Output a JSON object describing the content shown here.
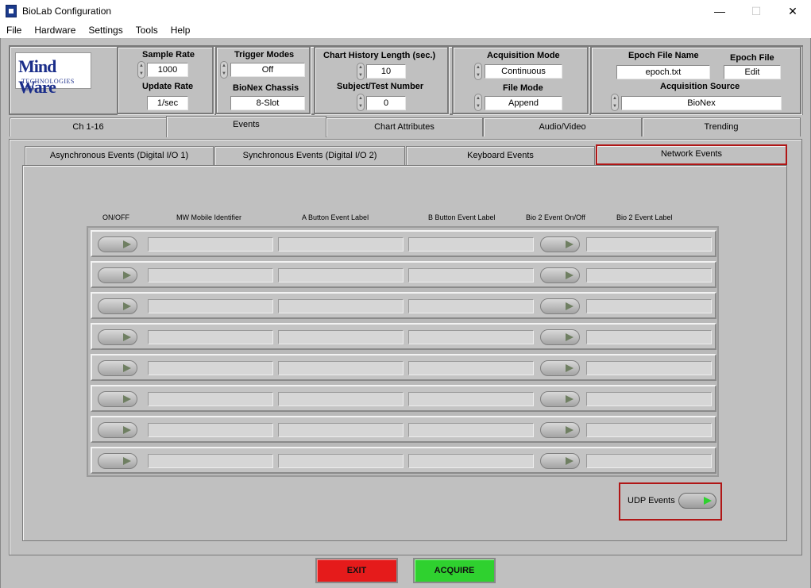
{
  "window": {
    "title": "BioLab Configuration",
    "minimize_glyph": "—",
    "maximize_glyph": "☐",
    "close_glyph": "✕"
  },
  "menu": [
    "File",
    "Hardware",
    "Settings",
    "Tools",
    "Help"
  ],
  "logo": {
    "main": "Mind Ware",
    "sub": "TECHNOLOGIES LTD."
  },
  "settings": {
    "sample_rate_label": "Sample Rate",
    "sample_rate": "1000",
    "update_rate_label": "Update Rate",
    "update_rate": "1/sec",
    "trigger_modes_label": "Trigger Modes",
    "trigger_modes": "Off",
    "bionex_chassis_label": "BioNex Chassis",
    "bionex_chassis": "8-Slot",
    "chart_history_label": "Chart History Length (sec.)",
    "chart_history": "10",
    "subject_test_label": "Subject/Test Number",
    "subject_test": "0",
    "acquisition_mode_label": "Acquisition Mode",
    "acquisition_mode": "Continuous",
    "file_mode_label": "File Mode",
    "file_mode": "Append",
    "epoch_file_name_label": "Epoch File Name",
    "epoch_file_name": "epoch.txt",
    "epoch_file_label": "Epoch File",
    "epoch_file_edit": "Edit",
    "acquisition_source_label": "Acquisition Source",
    "acquisition_source": "BioNex"
  },
  "tabs": [
    {
      "label": "Ch 1-16",
      "active": false
    },
    {
      "label": "Events",
      "active": true
    },
    {
      "label": "Chart Attributes",
      "active": false
    },
    {
      "label": "Audio/Video",
      "active": false
    },
    {
      "label": "Trending",
      "active": false
    }
  ],
  "subtabs": [
    {
      "label": "Asynchronous Events (Digital I/O 1)",
      "active": false
    },
    {
      "label": "Synchronous Events (Digital I/O 2)",
      "active": false
    },
    {
      "label": "Keyboard Events",
      "active": false
    },
    {
      "label": "Network Events",
      "active": true
    }
  ],
  "columns": [
    "ON/OFF",
    "MW Mobile Identifier",
    "A Button Event Label",
    "B Button Event Label",
    "Bio 2 Event On/Off",
    "Bio 2 Event Label"
  ],
  "rows": [
    {
      "mw_mobile_id": "",
      "a_label": "",
      "b_label": "",
      "bio2_label": ""
    },
    {
      "mw_mobile_id": "",
      "a_label": "",
      "b_label": "",
      "bio2_label": ""
    },
    {
      "mw_mobile_id": "",
      "a_label": "",
      "b_label": "",
      "bio2_label": ""
    },
    {
      "mw_mobile_id": "",
      "a_label": "",
      "b_label": "",
      "bio2_label": ""
    },
    {
      "mw_mobile_id": "",
      "a_label": "",
      "b_label": "",
      "bio2_label": ""
    },
    {
      "mw_mobile_id": "",
      "a_label": "",
      "b_label": "",
      "bio2_label": ""
    },
    {
      "mw_mobile_id": "",
      "a_label": "",
      "b_label": "",
      "bio2_label": ""
    },
    {
      "mw_mobile_id": "",
      "a_label": "",
      "b_label": "",
      "bio2_label": ""
    }
  ],
  "udp_events_label": "UDP Events",
  "buttons": {
    "exit": "EXIT",
    "acquire": "ACQUIRE"
  },
  "colors": {
    "panel_bg": "#c0c0c0",
    "exit_red": "#e51b1b",
    "acquire_green": "#2fd12f",
    "highlight_red": "#b01616",
    "udp_toggle_on": "#2fd12f"
  }
}
